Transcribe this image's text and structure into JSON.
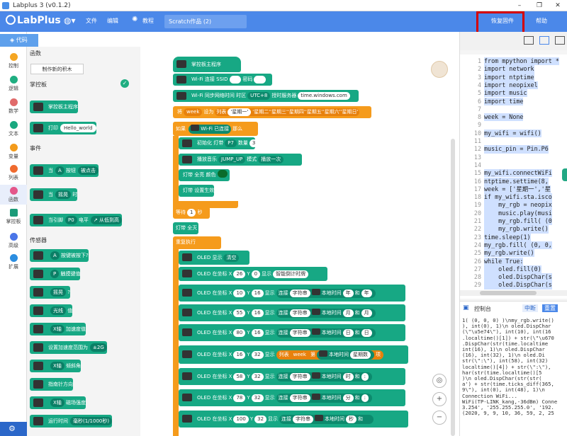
{
  "window": {
    "title": "Labplus 3 (v0.1.2)",
    "min": "–",
    "max": "❐",
    "close": "✕"
  },
  "navbar": {
    "logo": "LabPlus",
    "menu": [
      "文件",
      "编辑",
      "教程"
    ],
    "globe_icon": "globe-icon",
    "project_name": "Scratch作品 (2)",
    "restore_firmware": "恢复固件",
    "help": "帮助"
  },
  "code_tab": "代码",
  "categories": [
    {
      "label": "控制",
      "color": "#f5a623"
    },
    {
      "label": "逻辑",
      "color": "#1fae81"
    },
    {
      "label": "数学",
      "color": "#e06a6a"
    },
    {
      "label": "文本",
      "color": "#19a87f"
    },
    {
      "label": "变量",
      "color": "#f39b1b"
    },
    {
      "label": "列表",
      "color": "#ef6a2f"
    },
    {
      "label": "函数",
      "color": "#e4568a"
    },
    {
      "label": "掌控板",
      "color": "#1a9a78"
    },
    {
      "label": "高级",
      "color": "#4a76e8"
    },
    {
      "label": "扩展",
      "color": "#2b8de0"
    }
  ],
  "palette": {
    "top_section": "函数",
    "make_function": "制作新的积木",
    "board_section": "掌控板",
    "board_blocks": [
      "掌控板主程序",
      "打印",
      "Hello_world"
    ],
    "event_section": "事件",
    "event_blocks": [
      {
        "text": "当",
        "dd1": "A",
        "mid": "按钮",
        "dd2": "被点击"
      },
      {
        "text": "当",
        "dd1": "摇晃",
        "mid": "时"
      },
      {
        "text": "当引脚",
        "dd1": "P0",
        "mid": "电平",
        "dd2": "↗ 从低到高"
      }
    ],
    "sensor_section": "传感器",
    "sensor_blocks": [
      {
        "dd1": "A",
        "mid": "按键被按下?"
      },
      {
        "dd1": "P",
        "mid": "触摸键值"
      },
      {
        "dd1": "摇晃",
        "mid": "?"
      },
      {
        "dd1": "光线",
        "mid": "值"
      },
      {
        "dd1": "X轴",
        "mid": "加速度值"
      },
      {
        "pre": "设置加速度范围为",
        "dd1": "±2G"
      },
      {
        "dd1": "X轴",
        "mid": "倾斜角"
      },
      {
        "pre": "指南针方向"
      },
      {
        "dd1": "X轴",
        "mid": "磁场强度"
      },
      {
        "pre": "运行时间",
        "dd1": "毫秒(1/1000秒)"
      }
    ]
  },
  "workspace": {
    "main": "掌控板主程序",
    "wifi_connect": {
      "label": "Wi-Fi 连接 SSID",
      "pwd": "密码"
    },
    "ntp": {
      "label": "Wi-Fi 同步网络时间 时区",
      "tz": "UTC+8",
      "server_label": "授时服务器",
      "server": "time.windows.com"
    },
    "set_list": {
      "set": "将",
      "var": "week",
      "to": "设为",
      "list": "列表",
      "items": [
        "'星期一'",
        "'星期二'",
        "'星期三'",
        "'星期四'",
        "'星期五'",
        "'星期六'",
        "'星期日'"
      ]
    },
    "if": {
      "label": "如果",
      "cond": "Wi-Fi 已连接",
      "then": "那么"
    },
    "init_strip": {
      "label": "初始化 灯带",
      "pin": "P7",
      "count_label": "数量",
      "count": "3"
    },
    "play": {
      "label": "播放音乐",
      "music": "JUMP_UP",
      "mode_label": "模式",
      "mode": "播放一次"
    },
    "strip_color": "灯带 全亮 颜色",
    "strip_show": "灯带 设置生效",
    "wait": {
      "label": "等待",
      "value": "1",
      "unit": "秒"
    },
    "strip_off": "灯带 全灭",
    "forever": "重复执行",
    "oled_show": {
      "label": "OLED 显示",
      "dd": "清空"
    },
    "oled_rows": [
      {
        "x": "26",
        "y": "0",
        "tail": "智能倒计时牌"
      },
      {
        "x": "10",
        "y": "16",
        "join": "字符串",
        "time": "本地时间",
        "dd": "年",
        "and": "和",
        "unit": "年"
      },
      {
        "x": "55",
        "y": "16",
        "join": "字符串",
        "time": "本地时间",
        "dd": "月",
        "and": "和",
        "unit": "月"
      },
      {
        "x": "80",
        "y": "16",
        "join": "字符串",
        "time": "本地时间",
        "dd": "日",
        "and": "和",
        "unit": "日"
      },
      {
        "x": "16",
        "y": "32",
        "list": "列表",
        "var": "week",
        "idx_label": "第",
        "time": "本地时间",
        "dd": "星期数",
        "tail": "项"
      },
      {
        "x": "58",
        "y": "32",
        "join": "字符串",
        "time": "本地时间",
        "dd": "时",
        "and": "和",
        "unit": ":"
      },
      {
        "x": "78",
        "y": "32",
        "join": "字符串",
        "time": "本地时间",
        "dd": "分",
        "and": "和",
        "unit": ":"
      },
      {
        "x": "100",
        "y": "32",
        "join": "字符串",
        "time": "本地时间",
        "dd": "秒",
        "and": "和",
        "unit": ""
      }
    ],
    "oled_at": "OLED 在坐标 X",
    "y_label": "Y",
    "show_label": "显示",
    "join_label": "连接"
  },
  "code_lines": [
    "from mpython import *",
    "import network",
    "import ntptime",
    "import neopixel",
    "import music",
    "import time",
    "",
    "week = None",
    "",
    "my_wifi = wifi()",
    "",
    "music_pin = Pin.P6",
    "",
    "",
    "my_wifi.connectWiFi",
    "ntptime.settime(8,",
    "week = ['星期一','星",
    "if my_wifi.sta.isco",
    "    my_rgb = neopix",
    "    music.play(musi",
    "    my_rgb.fill( (0",
    "    my_rgb.write()",
    "time.sleep(1)",
    "my_rgb.fill( (0, 0,",
    "my_rgb.write()",
    "while True:",
    "    oled.fill(0)",
    "    oled.DispChar(s",
    "    oled.DispChar(s"
  ],
  "console": {
    "title": "控制台",
    "interrupt": "中断",
    "reset": "重置",
    "lines": [
      "1( (0, 0, 0) )\\nmy_rgb.write()",
      "), int(0), 1)\\n   oled.DispChar",
      "(\\\"\\u5e74\\\"), int(10), int(16",
      ".localtime()[1]) + str(\\\"\\u670",
      ".DispChar(str(time.localtime",
      " int(16), 1)\\n   oled.DispChar",
      "(16), int(32), 1)\\n    oled.Di",
      " str(\\\":\\\"), int(58), int(32)",
      "localtime()[4]) + str(\\\":\\\"),",
      "har(str(time.localtime()[5",
      ")\\n   oled.DispChar(str(str(",
      "a') + str(time.ticks_diff(365,",
      "9\\\"), int(0), int(48), 1)\\n",
      "Connection WiFi...",
      "WiFi(TP-LINK_kang,-36dBm) Conne",
      "3.254', '255.255.255.0', '192.",
      "(2020, 9, 9, 10, 36, 59, 2, 25"
    ]
  }
}
